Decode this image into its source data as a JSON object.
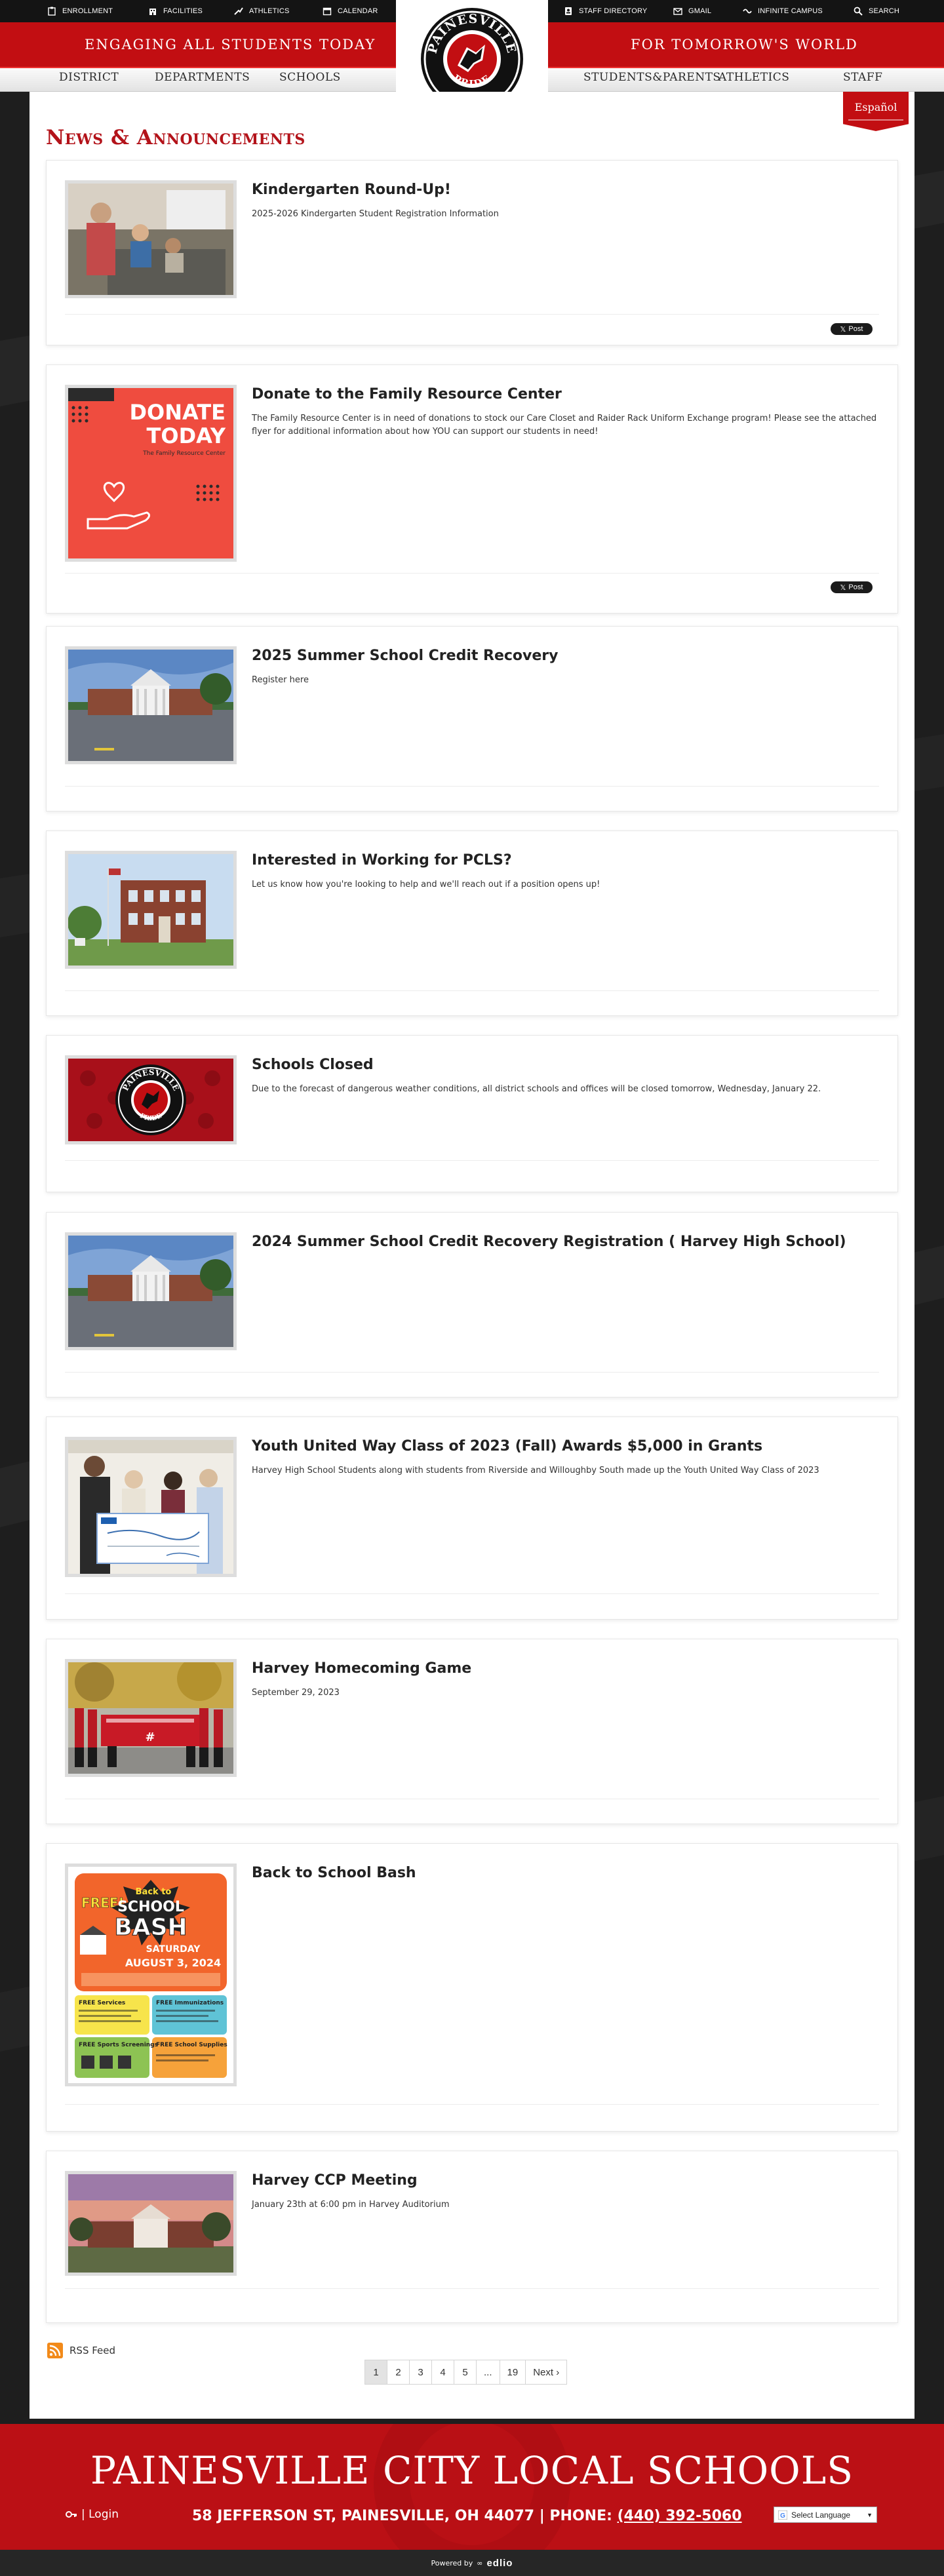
{
  "topbar": {
    "left": [
      {
        "label": "ENROLLMENT",
        "icon": "clipboard-icon"
      },
      {
        "label": "FACILITIES",
        "icon": "building-icon"
      },
      {
        "label": "ATHLETICS",
        "icon": "athletics-icon"
      },
      {
        "label": "CALENDAR",
        "icon": "calendar-icon"
      }
    ],
    "right": [
      {
        "label": "STAFF DIRECTORY",
        "icon": "directory-icon"
      },
      {
        "label": "GMAIL",
        "icon": "mail-icon"
      },
      {
        "label": "INFINITE CAMPUS",
        "icon": "campus-icon"
      },
      {
        "label": "SEARCH",
        "icon": "search-icon"
      }
    ]
  },
  "banner": {
    "left_tagline": "ENGAGING ALL STUDENTS TODAY",
    "right_tagline": "FOR TOMORROW'S WORLD"
  },
  "logo": {
    "top_text": "PAINESVILLE",
    "bottom_text": "PRIDE"
  },
  "nav": [
    "DISTRICT",
    "DEPARTMENTS",
    "SCHOOLS",
    "STUDENTS&PARENTS",
    "ATHLETICS",
    "STAFF"
  ],
  "espanol": "Español",
  "page_title": "News & Announcements",
  "tweet_label": "Post",
  "news": [
    {
      "title": "Kindergarten Round-Up!",
      "description": "2025-2026 Kindergarten Student Registration Information",
      "image": "classroom-photo"
    },
    {
      "title": "Donate to the Family Resource Center",
      "description": "The Family Resource Center is in need of donations to stock our Care Closet and Raider Rack Uniform Exchange program! Please see the attached flyer for additional information about how YOU can support our students in need!",
      "image": "donate-flyer",
      "flyer_heading_1": "DONATE",
      "flyer_heading_2": "TODAY",
      "flyer_sub": "The Family Resource Center"
    },
    {
      "title": "2025 Summer School Credit Recovery",
      "description": "Register here",
      "image": "school-building-photo"
    },
    {
      "title": "Interested in Working for PCLS?",
      "description": "Let us know how you're looking to help and we'll reach out if a position opens up!",
      "image": "brick-school-photo"
    },
    {
      "title": "Schools Closed",
      "description": "Due to the forecast of dangerous weather conditions, all district schools and offices will be closed tomorrow, Wednesday, January 22.",
      "image": "pride-logo-graphic",
      "logo_top": "PAINESVILLE",
      "logo_bottom": "PRIDE"
    },
    {
      "title": "2024 Summer School Credit Recovery Registration ( Harvey High School)",
      "description": "",
      "image": "school-building-photo"
    },
    {
      "title": "Youth United Way Class of 2023 (Fall) Awards $5,000 in Grants",
      "description": "Harvey High School Students along with students from Riverside and Willoughby South made up the Youth United Way Class of 2023",
      "image": "check-presentation-photo"
    },
    {
      "title": "Harvey Homecoming Game",
      "description": "September 29, 2023",
      "image": "marching-band-photo"
    },
    {
      "title": "Back to School Bash",
      "description": "",
      "image": "bash-flyer",
      "flyer_free": "FREE!",
      "flyer_back": "Back to",
      "flyer_school": "SCHOOL",
      "flyer_bash": "BASH",
      "flyer_day": "SATURDAY",
      "flyer_date": "AUGUST 3, 2024",
      "flyer_box1": "FREE Services",
      "flyer_box2": "FREE Immunizations",
      "flyer_box3": "FREE Sports Screenings",
      "flyer_box4": "FREE School Supplies"
    },
    {
      "title": "Harvey CCP Meeting",
      "description": "January 23th at 6:00 pm in Harvey Auditorium",
      "image": "school-dusk-photo"
    }
  ],
  "rss_label": "RSS Feed",
  "pagination": [
    "1",
    "2",
    "3",
    "4",
    "5",
    "...",
    "19",
    "Next ›"
  ],
  "footer": {
    "district_name": "PAINESVILLE CITY LOCAL SCHOOLS",
    "login": "| Login",
    "address": "58 JEFFERSON ST, PAINESVILLE, OH 44077 | PHONE: ",
    "phone": "(440) 392-5060",
    "language": "Select Language",
    "powered_by": "Powered by",
    "brand": "edlio"
  },
  "colors": {
    "brand_red": "#c20e12",
    "title_red": "#b3131a",
    "dark": "#1c1c1c"
  }
}
